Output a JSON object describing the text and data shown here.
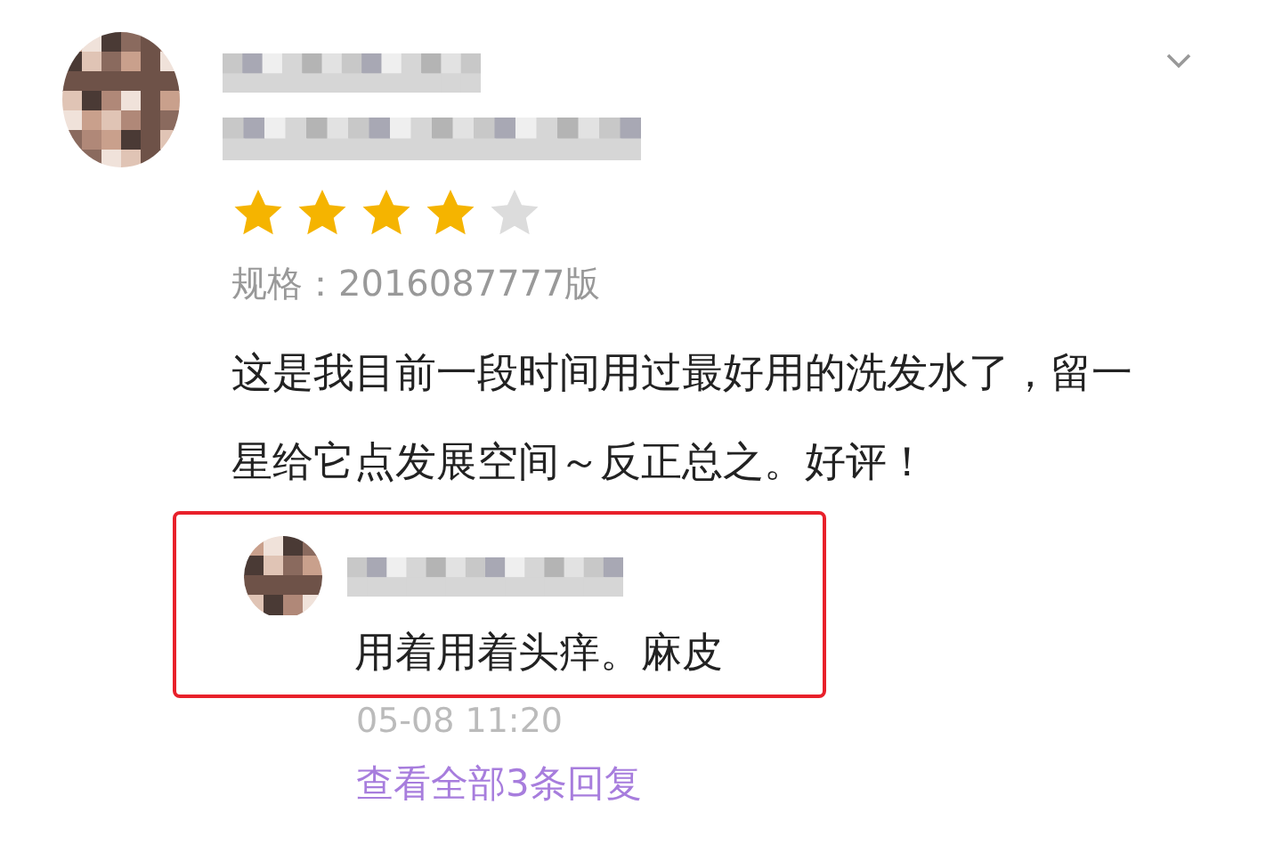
{
  "review": {
    "stars": 4,
    "spec": "规格：2016087777版",
    "text": "这是我目前一段时间用过最好用的洗发水了，留一星给它点发展空间～反正总之。好评！"
  },
  "reply": {
    "highlighted": true,
    "text": "用着用着头痒。麻皮",
    "time": "05-08 11:20"
  },
  "more_replies": "查看全部3条回复"
}
